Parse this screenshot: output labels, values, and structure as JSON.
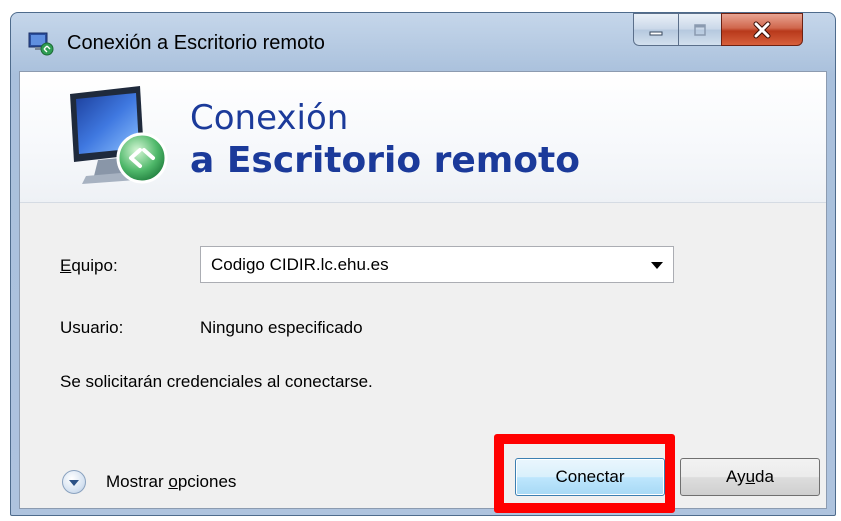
{
  "window": {
    "title": "Conexión a Escritorio remoto",
    "controls": [
      "minimize-icon",
      "maximize-icon",
      "close-icon"
    ]
  },
  "banner": {
    "line1": "Conexión",
    "line2": "a Escritorio remoto"
  },
  "form": {
    "equipo_label_mnemonic": "E",
    "equipo_label_rest": "quipo:",
    "equipo_value": "Codigo CIDIR.lc.ehu.es",
    "usuario_label": "Usuario:",
    "usuario_value": "Ninguno especificado",
    "notice": "Se solicitarán credenciales al conectarse."
  },
  "options": {
    "label_prefix": "Mostrar ",
    "label_mnemonic": "o",
    "label_suffix": "pciones"
  },
  "buttons": {
    "connect": "Conectar",
    "help_prefix": "Ay",
    "help_mnemonic": "u",
    "help_suffix": "da"
  },
  "colors": {
    "banner_text": "#1b3a9a",
    "highlight": "#ff0000",
    "close_button": "#c8462a"
  }
}
